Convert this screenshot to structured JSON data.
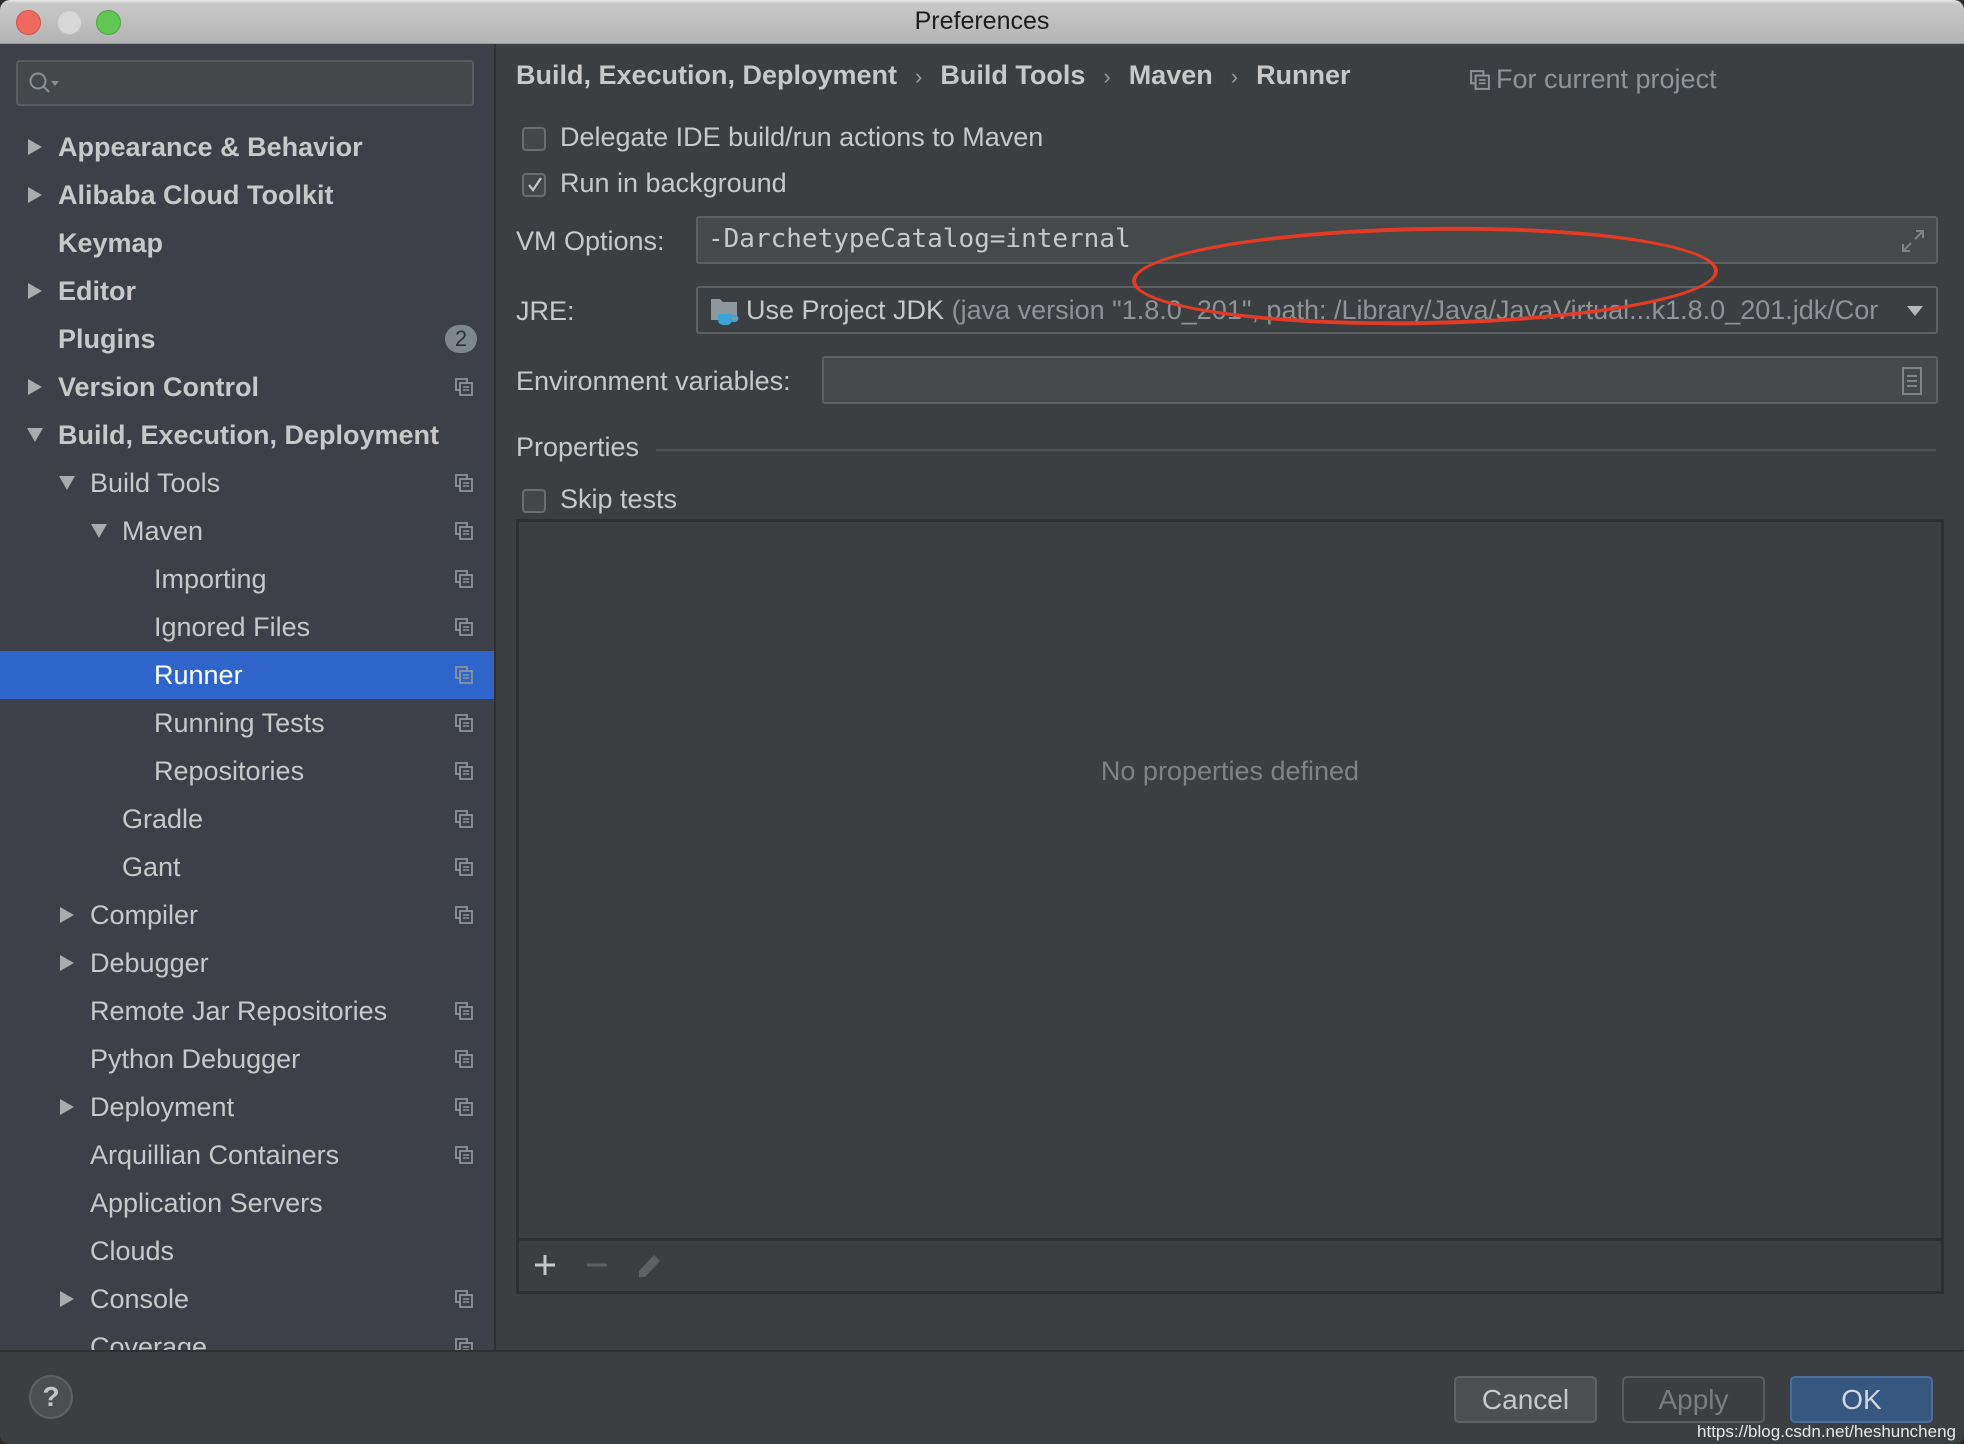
{
  "window": {
    "title": "Preferences"
  },
  "sidebar": {
    "search_placeholder": "",
    "items": [
      {
        "label": "Appearance & Behavior",
        "level": 0,
        "expander": "collapsed",
        "bold": true,
        "project_icon": false
      },
      {
        "label": "Alibaba Cloud Toolkit",
        "level": 0,
        "expander": "collapsed",
        "bold": true,
        "project_icon": false
      },
      {
        "label": "Keymap",
        "level": 0,
        "expander": "none",
        "bold": true,
        "project_icon": false
      },
      {
        "label": "Editor",
        "level": 0,
        "expander": "collapsed",
        "bold": true,
        "project_icon": false
      },
      {
        "label": "Plugins",
        "level": 0,
        "expander": "none",
        "bold": true,
        "project_icon": false,
        "badge": "2"
      },
      {
        "label": "Version Control",
        "level": 0,
        "expander": "collapsed",
        "bold": true,
        "project_icon": true
      },
      {
        "label": "Build, Execution, Deployment",
        "level": 0,
        "expander": "expanded",
        "bold": true,
        "project_icon": false
      },
      {
        "label": "Build Tools",
        "level": 1,
        "expander": "expanded",
        "bold": false,
        "project_icon": true
      },
      {
        "label": "Maven",
        "level": 2,
        "expander": "expanded",
        "bold": false,
        "project_icon": true
      },
      {
        "label": "Importing",
        "level": 3,
        "expander": "none",
        "bold": false,
        "project_icon": true
      },
      {
        "label": "Ignored Files",
        "level": 3,
        "expander": "none",
        "bold": false,
        "project_icon": true
      },
      {
        "label": "Runner",
        "level": 3,
        "expander": "none",
        "bold": false,
        "project_icon": true,
        "selected": true
      },
      {
        "label": "Running Tests",
        "level": 3,
        "expander": "none",
        "bold": false,
        "project_icon": true
      },
      {
        "label": "Repositories",
        "level": 3,
        "expander": "none",
        "bold": false,
        "project_icon": true
      },
      {
        "label": "Gradle",
        "level": 2,
        "expander": "none",
        "bold": false,
        "project_icon": true
      },
      {
        "label": "Gant",
        "level": 2,
        "expander": "none",
        "bold": false,
        "project_icon": true
      },
      {
        "label": "Compiler",
        "level": 1,
        "expander": "collapsed",
        "bold": false,
        "project_icon": true
      },
      {
        "label": "Debugger",
        "level": 1,
        "expander": "collapsed",
        "bold": false,
        "project_icon": false
      },
      {
        "label": "Remote Jar Repositories",
        "level": 1,
        "expander": "none",
        "bold": false,
        "project_icon": true
      },
      {
        "label": "Python Debugger",
        "level": 1,
        "expander": "none",
        "bold": false,
        "project_icon": true
      },
      {
        "label": "Deployment",
        "level": 1,
        "expander": "collapsed",
        "bold": false,
        "project_icon": true
      },
      {
        "label": "Arquillian Containers",
        "level": 1,
        "expander": "none",
        "bold": false,
        "project_icon": true
      },
      {
        "label": "Application Servers",
        "level": 1,
        "expander": "none",
        "bold": false,
        "project_icon": false
      },
      {
        "label": "Clouds",
        "level": 1,
        "expander": "none",
        "bold": false,
        "project_icon": false
      },
      {
        "label": "Console",
        "level": 1,
        "expander": "collapsed",
        "bold": false,
        "project_icon": true
      },
      {
        "label": "Coverage",
        "level": 1,
        "expander": "none",
        "bold": false,
        "project_icon": true
      }
    ]
  },
  "content": {
    "breadcrumb": [
      "Build, Execution, Deployment",
      "Build Tools",
      "Maven",
      "Runner"
    ],
    "breadcrumb_separator": "›",
    "scope_label": "For current project",
    "delegate": {
      "label": "Delegate IDE build/run actions to Maven",
      "checked": false
    },
    "run_in_background": {
      "label": "Run in background",
      "checked": true
    },
    "vm_options": {
      "label": "VM Options:",
      "value": "-DarchetypeCatalog=internal"
    },
    "jre": {
      "label": "JRE:",
      "value": "Use Project JDK",
      "detail": "(java version \"1.8.0_201\", path: /Library/Java/JavaVirtual...k1.8.0_201.jdk/Cor"
    },
    "env_vars": {
      "label": "Environment variables:",
      "value": ""
    },
    "properties": {
      "section_title": "Properties",
      "skip_tests": {
        "label": "Skip tests",
        "checked": false
      },
      "empty_text": "No properties defined",
      "toolbar": [
        "add-icon",
        "remove-icon",
        "edit-icon"
      ]
    }
  },
  "footer": {
    "help_label": "?",
    "cancel_label": "Cancel",
    "apply_label": "Apply",
    "ok_label": "OK",
    "watermark": "https://blog.csdn.net/heshuncheng"
  },
  "colors": {
    "selection": "#2f65ca",
    "ok_button": "#365880",
    "annotation_ellipse": "#e33b25"
  }
}
